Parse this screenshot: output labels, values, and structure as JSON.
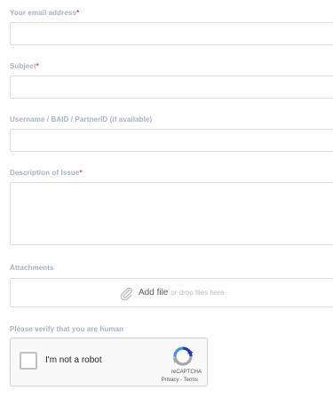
{
  "fields": {
    "email": {
      "label": "Your email address",
      "required_mark": "*",
      "value": ""
    },
    "subject": {
      "label": "Subject",
      "required_mark": "*",
      "value": ""
    },
    "username": {
      "label": "Username / BAID / PartnerID (if available)",
      "value": ""
    },
    "description": {
      "label": "Description of Issue",
      "required_mark": "*",
      "value": ""
    }
  },
  "attachments": {
    "label": "Attachments",
    "add_file_label": "Add file",
    "drop_hint": "or drop files here",
    "icon": "paperclip-icon"
  },
  "verify": {
    "label": "Please verify that you are human",
    "checkbox_label": "I'm not a robot",
    "checked": false,
    "brand": "reCAPTCHA",
    "privacy_link": "Privacy",
    "separator": " - ",
    "terms_link": "Terms",
    "icon": "recaptcha-logo-icon"
  },
  "colors": {
    "label": "#a7b1c2",
    "required": "#e8474a",
    "border": "#d9dde3",
    "recaptcha_blue": "#4a90e2",
    "recaptcha_dark": "#1c3aa9",
    "recaptcha_gray": "#a6a6a6"
  }
}
